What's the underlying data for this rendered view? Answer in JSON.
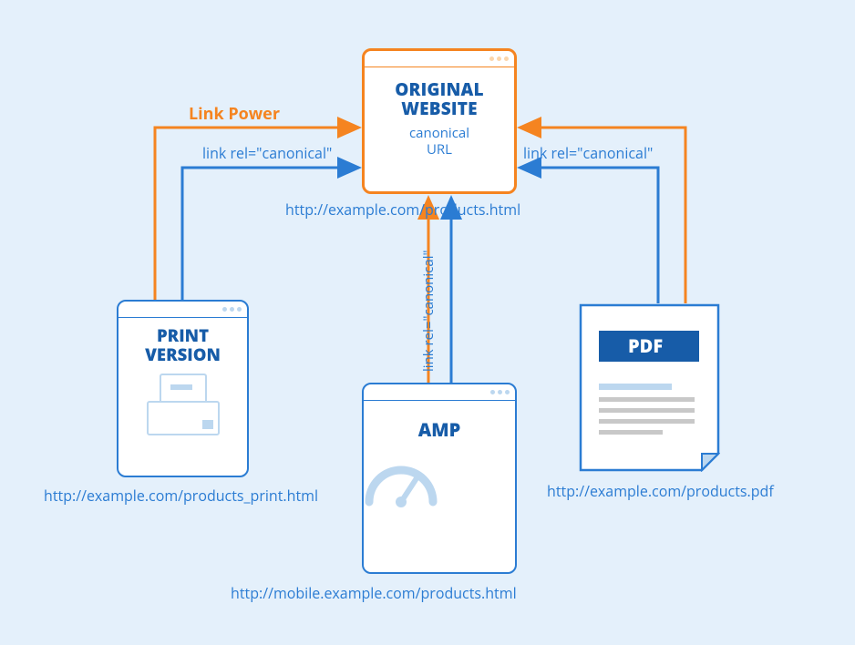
{
  "nodes": {
    "original": {
      "title_line1": "ORIGINAL",
      "title_line2": "WEBSITE",
      "sub_line1": "canonical",
      "sub_line2": "URL",
      "url": "http://example.com/products.html"
    },
    "print": {
      "title_line1": "PRINT",
      "title_line2": "VERSION",
      "url": "http://example.com/products_print.html"
    },
    "amp": {
      "title": "AMP",
      "url": "http://mobile.example.com/products.html"
    },
    "pdf": {
      "title": "PDF",
      "url": "http://example.com/products.pdf"
    }
  },
  "labels": {
    "link_power": "Link Power",
    "canonical_left": "link rel=\"canonical\"",
    "canonical_right": "link rel=\"canonical\"",
    "canonical_mid": "link rel=\"canonical\""
  },
  "colors": {
    "blue": "#2b7cd3",
    "dark_blue": "#175ca8",
    "orange": "#f58420",
    "light_blue": "#bcd7ef",
    "bg": "#e4f0fb",
    "grey": "#c8c8c8"
  }
}
